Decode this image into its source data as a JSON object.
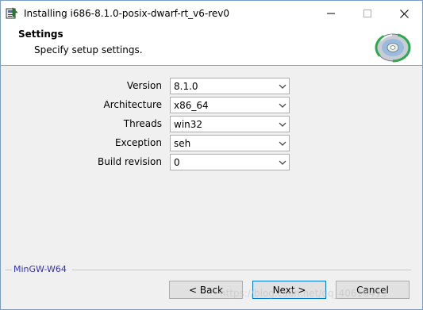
{
  "window": {
    "title": "Installing i686-8.1.0-posix-dwarf-rt_v6-rev0"
  },
  "header": {
    "title": "Settings",
    "subtitle": "Specify setup settings."
  },
  "settings": [
    {
      "label": "Version",
      "value": "8.1.0"
    },
    {
      "label": "Architecture",
      "value": "x86_64"
    },
    {
      "label": "Threads",
      "value": "win32"
    },
    {
      "label": "Exception",
      "value": "seh"
    },
    {
      "label": "Build revision",
      "value": "0"
    }
  ],
  "footer": {
    "brand": "MinGW-W64",
    "back_label": "< Back",
    "next_label": "Next >",
    "cancel_label": "Cancel"
  },
  "watermark": "https://blog.csdn.net/qq_40618413",
  "colors": {
    "accent": "#0078d7",
    "brand_text": "#3030c0"
  },
  "icons": {
    "app": "installer-icon",
    "header": "cd-disc-icon"
  }
}
